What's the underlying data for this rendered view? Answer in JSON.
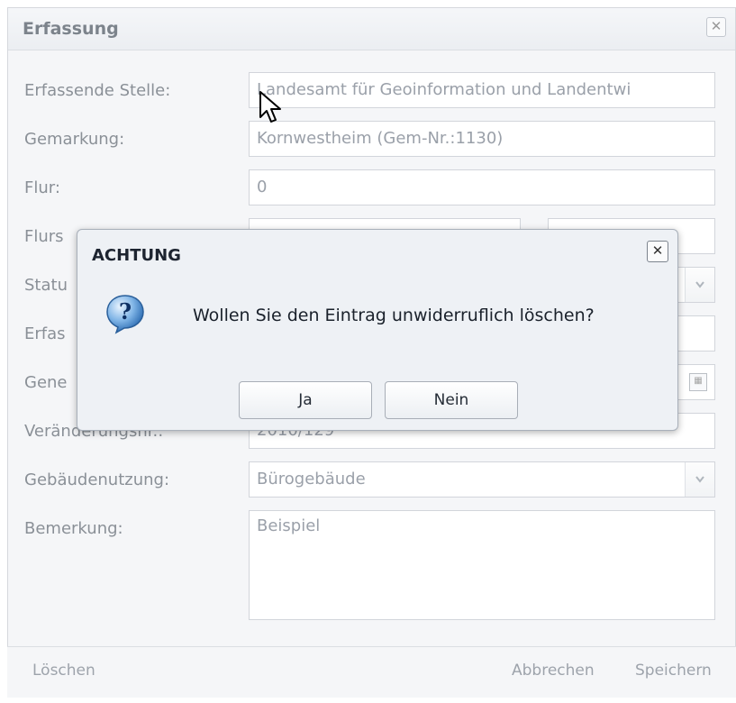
{
  "window": {
    "title": "Erfassung",
    "close_symbol": "✕"
  },
  "form": {
    "rows": [
      {
        "label": "Erfassende Stelle:",
        "value": "Landesamt für Geoinformation und Landentwi"
      },
      {
        "label": "Gemarkung:",
        "value": "Kornwestheim (Gem-Nr.:1130)"
      },
      {
        "label": "Flur:",
        "value": "0"
      },
      {
        "label": "Flurs",
        "value": ""
      },
      {
        "label": "Statu",
        "value": ""
      },
      {
        "label": "Erfas",
        "value": ""
      },
      {
        "label": "Gene",
        "value": ""
      },
      {
        "label": "Veränderungsnr.:",
        "value": "2010/129"
      },
      {
        "label": "Gebäudenutzung:",
        "value": "Bürogebäude"
      },
      {
        "label": "Bemerkung:",
        "value": "Beispiel"
      }
    ]
  },
  "footer": {
    "delete_label": "Löschen",
    "cancel_label": "Abbrechen",
    "save_label": "Speichern"
  },
  "dialog": {
    "title": "ACHTUNG",
    "message": "Wollen Sie den Eintrag unwiderruflich löschen?",
    "yes_label": "Ja",
    "no_label": "Nein",
    "close_symbol": "✕"
  },
  "icons": {
    "question": "question-icon",
    "calendar": "calendar-icon",
    "combo": "chevron-down-icon"
  }
}
